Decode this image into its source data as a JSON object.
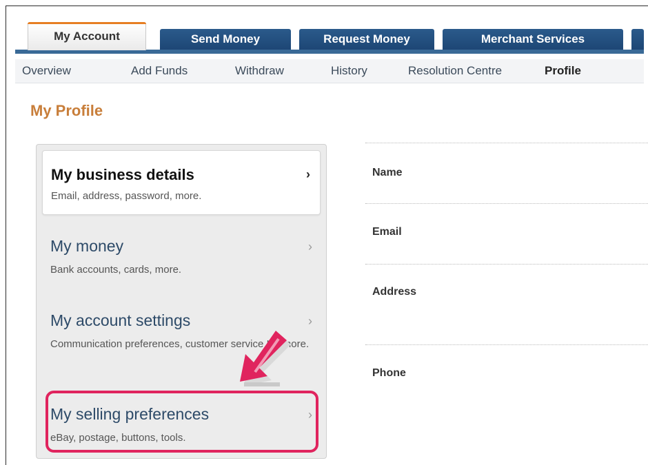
{
  "tabs": [
    {
      "label": "My Account",
      "active": true
    },
    {
      "label": "Send Money",
      "active": false
    },
    {
      "label": "Request Money",
      "active": false
    },
    {
      "label": "Merchant Services",
      "active": false
    }
  ],
  "subnav": [
    {
      "label": "Overview",
      "current": false
    },
    {
      "label": "Add Funds",
      "current": false
    },
    {
      "label": "Withdraw",
      "current": false
    },
    {
      "label": "History",
      "current": false
    },
    {
      "label": "Resolution Centre",
      "current": false
    },
    {
      "label": "Profile",
      "current": true
    }
  ],
  "page_title": "My Profile",
  "sidebar": {
    "items": [
      {
        "title": "My business details",
        "subtitle": "Email, address, password, more.",
        "active": true
      },
      {
        "title": "My money",
        "subtitle": "Bank accounts, cards, more.",
        "active": false
      },
      {
        "title": "My account settings",
        "subtitle": "Communication preferences, customer service ID, more.",
        "active": false
      },
      {
        "title": "My selling preferences",
        "subtitle": "eBay, postage, buttons, tools.",
        "active": false,
        "highlighted": true
      }
    ]
  },
  "details": {
    "labels": [
      "Name",
      "Email",
      "Address",
      "Phone"
    ]
  },
  "colors": {
    "tab_blue": "#1d4675",
    "accent_orange": "#c87e3a",
    "highlight_pink": "#e0245e",
    "link_blue": "#2d4a68"
  },
  "icons": {
    "chevron": "chevron-right-icon",
    "pointer": "pointer-arrow-icon"
  }
}
